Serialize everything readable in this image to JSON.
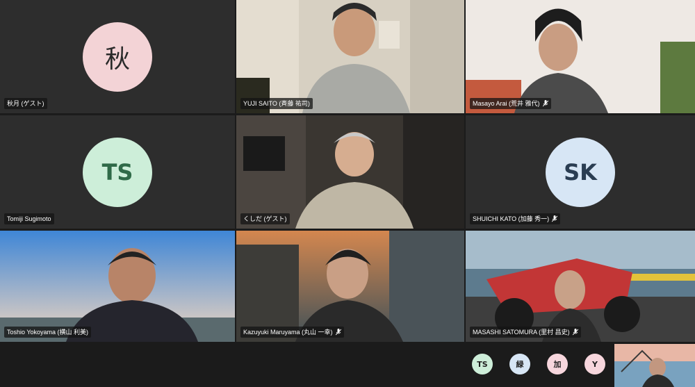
{
  "participants": [
    {
      "name": "秋月 (ゲスト)",
      "initials": "秋",
      "avatar_color": "#f3d3d6",
      "muted": false,
      "video": false
    },
    {
      "name": "YUJI SAITO (斉藤 祐司)",
      "muted": false,
      "video": true
    },
    {
      "name": "Masayo Arai (荒井 雅代)",
      "muted": true,
      "video": true
    },
    {
      "name": "Tomiji Sugimoto",
      "initials": "TS",
      "avatar_color": "#cdeed9",
      "muted": false,
      "video": false
    },
    {
      "name": "くしだ (ゲスト)",
      "muted": false,
      "video": true
    },
    {
      "name": "SHUICHI KATO (加藤 秀一)",
      "initials": "SK",
      "avatar_color": "#d7e6f5",
      "muted": true,
      "video": false
    },
    {
      "name": "Toshio Yokoyama (横山 利美)",
      "muted": false,
      "video": true
    },
    {
      "name": "Kazuyuki Maruyama (丸山 一幸)",
      "muted": true,
      "video": true
    },
    {
      "name": "MASASHI SATOMURA (里村 昌史)",
      "muted": true,
      "video": true
    }
  ],
  "overflow_participants": [
    {
      "initials": "TS",
      "color": "#cdeed9"
    },
    {
      "initials": "緑",
      "color": "#d7e6f5"
    },
    {
      "initials": "加",
      "color": "#f7d6dd"
    },
    {
      "initials": "Y",
      "color": "#f7d6dd"
    }
  ]
}
